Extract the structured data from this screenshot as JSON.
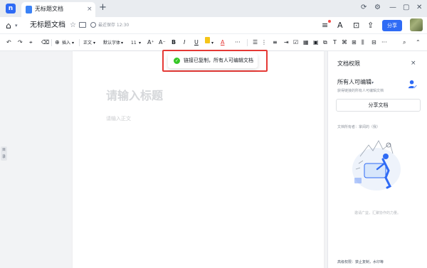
{
  "tabbar": {
    "app_icon": "kdocs-logo-icon",
    "app_logo_text": "n",
    "tab_title": "无标题文档",
    "close_icon": "×",
    "new_tab_icon": "+",
    "window_controls": [
      "⟳",
      "⚙",
      "—",
      "▢",
      "✕"
    ]
  },
  "header": {
    "home_icon": "⌂",
    "home_caret": "▾",
    "doc_title": "无标题文档",
    "star_icon": "☆",
    "save_status": "最近保存 12:30",
    "icons": [
      "≡",
      "A",
      "⊡",
      "⇪"
    ],
    "share_label": "分享",
    "accent_color": "#2f6bf5"
  },
  "toolbar": {
    "undo": "↶",
    "redo": "↷",
    "format_painter": "⌖",
    "clear_format": "⌫",
    "insert_icon": "⊕",
    "insert_label": "插入",
    "insert_caret": "▾",
    "style_label": "正文",
    "style_caret": "▾",
    "font_label": "默认字体",
    "font_caret": "▾",
    "size_label": "11",
    "size_caret": "▾",
    "grow": "A⁺",
    "shrink": "A⁻",
    "bold": "B",
    "italic": "I",
    "underline": "U",
    "highlight": "▾",
    "font_color": "A",
    "more": "···",
    "list_bullets": "☰",
    "list_numbers": "⋮",
    "align": "≡",
    "indent": "⇥",
    "checkbox": "☑",
    "table": "▦",
    "image": "▣",
    "link": "⧉",
    "text_box": "T",
    "symbols": "⌘",
    "grid": "⊞",
    "columns": "⫼",
    "layout": "⊟",
    "more2": "···",
    "search": "⌕",
    "collapse": "⌃"
  },
  "toast": {
    "message": "链接已复制，所有人可编辑文档",
    "icon_check": "✓",
    "status_color": "#34c724",
    "highlight_color": "#e53935"
  },
  "editor": {
    "title_placeholder": "请输入标题",
    "body_placeholder": "请输入正文"
  },
  "left_handle": {
    "label": "目录"
  },
  "panel": {
    "title": "文档权限",
    "close_icon": "×",
    "permission_label": "所有人可编辑",
    "permission_caret": "▾",
    "permission_desc": "获得链接的所有人可编辑文档",
    "share_doc_label": "分享文档",
    "owner_label": "文档所有者：掌阅的（我）",
    "empty_text": "邀请广益，汇聚协作的力量。",
    "advanced_label": "高级权限：禁止复制，水印等"
  }
}
